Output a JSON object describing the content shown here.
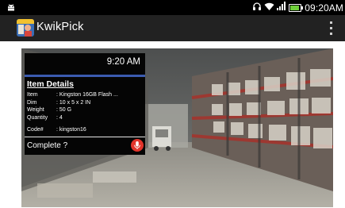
{
  "status_bar": {
    "time": "09:20AM",
    "icons": [
      "android-icon",
      "headset-icon",
      "wifi-icon",
      "signal-icon",
      "battery-icon"
    ]
  },
  "action_bar": {
    "title": "KwikPick",
    "overflow_icon": "more-vert-icon"
  },
  "card": {
    "time": "9:20 AM",
    "heading": "Item Details",
    "fields": [
      {
        "label": "Item",
        "value": ": Kingston 16GB Flash ..."
      },
      {
        "label": "Dim",
        "value": ": 10 x 5 x 2 IN"
      },
      {
        "label": "Weight",
        "value": ": 50 G"
      },
      {
        "label": "Quantity",
        "value": ": 4"
      }
    ],
    "code": {
      "label": "Code#",
      "value": ": kingston16"
    },
    "prompt": "Complete ?",
    "mic_icon": "microphone-icon"
  },
  "colors": {
    "status_bar": "#000000",
    "action_bar": "#222222",
    "accent_bar": "#3b5bb0",
    "mic_button": "#e3342b"
  }
}
